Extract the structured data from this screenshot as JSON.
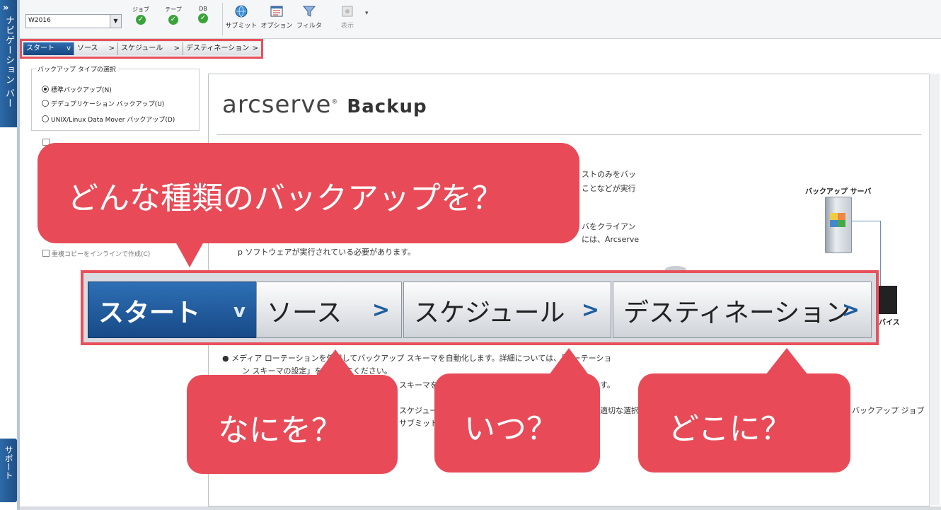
{
  "nav_bar": {
    "title": "ナビゲーション バー",
    "chevron": "»"
  },
  "support_bar": {
    "title": "サポート"
  },
  "toolbar": {
    "server": "W2016",
    "status": [
      {
        "label": "ジョブ",
        "icon": "check-icon"
      },
      {
        "label": "テープ",
        "icon": "check-icon"
      },
      {
        "label": "DB",
        "icon": "check-icon"
      }
    ],
    "submit_label": "サブミット",
    "options_label": "オプション",
    "filter_label": "フィルタ",
    "view_label": "表示",
    "more": "▾"
  },
  "steps": [
    {
      "label": "スタート",
      "arrow": "v"
    },
    {
      "label": "ソース",
      "arrow": ">"
    },
    {
      "label": "スケジュール",
      "arrow": ">"
    },
    {
      "label": "デスティネーション",
      "arrow": ">"
    }
  ],
  "backup_type": {
    "legend": "バックアップ タイプの選択",
    "options": [
      {
        "label": "標準バックアップ(N)",
        "selected": true
      },
      {
        "label": "デデュプリケーション バックアップ(U)",
        "selected": false
      },
      {
        "label": "UNIX/Linux Data Mover バックアップ(D)",
        "selected": false
      }
    ],
    "inline_copy": "重複コピーをインラインで作成(C)"
  },
  "content": {
    "brand": "arcserve",
    "reg": "®",
    "product": "Backup",
    "line1": "ストのみをバッ",
    "line2": "ことなどが実行",
    "line3": "バをクライアン",
    "line4": "には、Arcserve",
    "line5": "p ソフトウェアが実行されている必要があります。",
    "line6": "● メディア ローテーションを使用してバックアップ スキーマを自動化します。詳細については、「ローテーショ",
    "line7": "ン スキーマの設定」を参照してください。",
    "line8": "スキーマを",
    "line9": "す。",
    "line10": "スケジュー",
    "line11": "適切な選択",
    "line12": "バックアップ ジョブ",
    "line13": "サブミット",
    "server_label": "バックアップ サーバ",
    "device_label": "バイス"
  },
  "callouts": {
    "main": "どんな種類のバックアップを？",
    "what": "なにを？",
    "when": "いつ？",
    "where": "どこに？"
  },
  "colors": {
    "accent": "#e84b57",
    "active_step": "#1f5a9a"
  }
}
